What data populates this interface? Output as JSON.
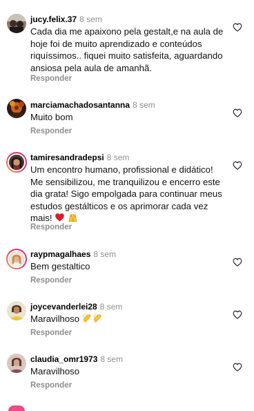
{
  "comments": [
    {
      "username": "jucy.felix.37",
      "time": "8 sem",
      "text": "Cada dia me apaixono pela gestalt,e na aula de hoje foi de muito aprendizado e conteúdos riquíssimos.. fiquei muito satisfeita, aguardando ansiosa pela aula de amanhã.",
      "reply_label": "Responder",
      "avatar_color": "#6b5b4d"
    },
    {
      "username": "marciamachadosantanna",
      "time": "8 sem",
      "text": "Muito bom",
      "reply_label": "Responder",
      "avatar_color": "#c05a1a"
    },
    {
      "username": "tamiresandradepsi",
      "time": "8 sem",
      "text": "Um encontro humano, profissional e didático! Me sensibilizou, me tranquilizou e encerro este dia grata! Sigo empolgada para continuar meus estudos gestálticos e os aprimorar cada vez mais!",
      "emojis": [
        "red-heart",
        "raising-hands"
      ],
      "reply_label": "Responder",
      "avatar_color": "#3a2a24"
    },
    {
      "username": "raypmagalhaes",
      "time": "8 sem",
      "text": "Bem gestaltico",
      "reply_label": "Responder",
      "avatar_color": "#d9b38c"
    },
    {
      "username": "joycevanderlei28",
      "time": "8 sem",
      "text": "Maravilhoso",
      "emojis": [
        "clapping-hands",
        "clapping-hands"
      ],
      "reply_label": "Responder",
      "avatar_color": "#c9a25a"
    },
    {
      "username": "claudia_omr1973",
      "time": "8 sem",
      "text": "Maravilhoso",
      "reply_label": "Responder",
      "avatar_color": "#9a6b62"
    }
  ],
  "icons": {
    "like": "heart-outline-icon"
  },
  "colors": {
    "text": "#111111",
    "muted": "#8e8e8e",
    "story_ring": "#e1306c"
  }
}
